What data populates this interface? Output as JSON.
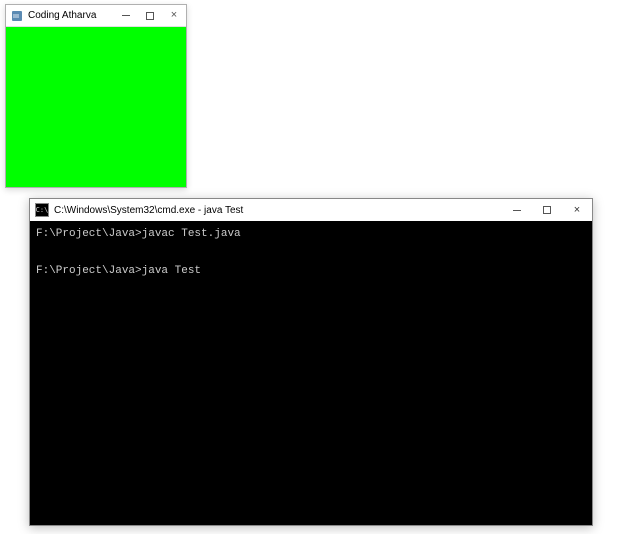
{
  "java_window": {
    "title": "Coding Atharva",
    "content_color": "#00ff00"
  },
  "cmd_window": {
    "icon_text": "C:\\",
    "title": "C:\\Windows\\System32\\cmd.exe - java  Test",
    "lines": [
      {
        "prompt": "F:\\Project\\Java>",
        "command": "javac Test.java"
      },
      {
        "prompt": "F:\\Project\\Java>",
        "command": "java Test"
      }
    ]
  }
}
